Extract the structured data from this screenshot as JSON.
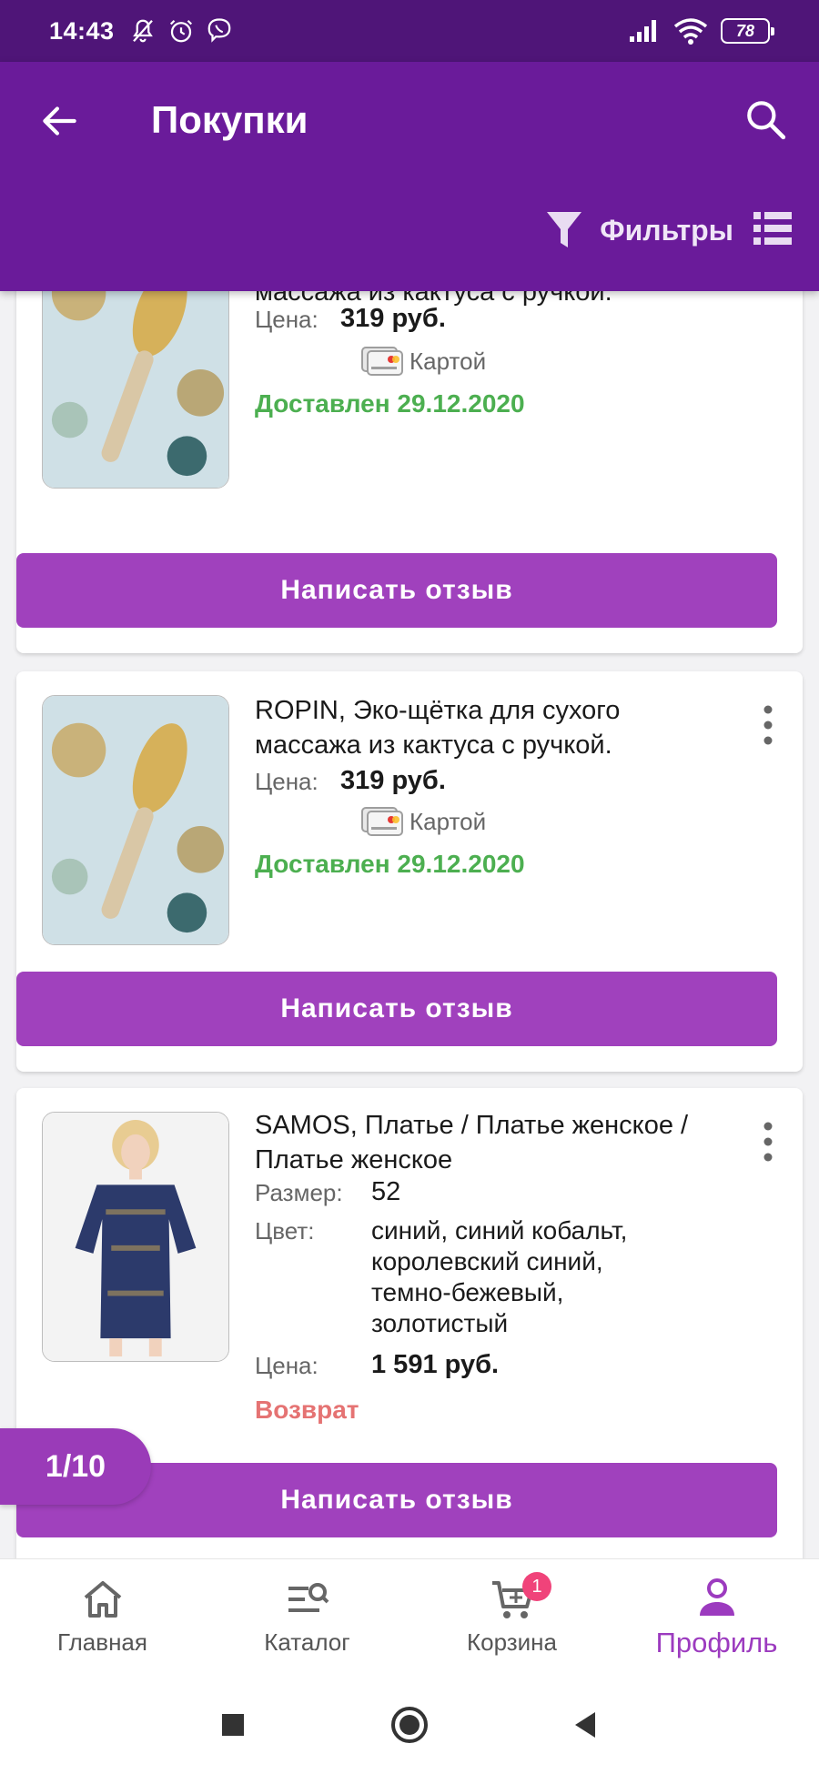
{
  "status_bar": {
    "time": "14:43",
    "battery": "78"
  },
  "header": {
    "title": "Покупки",
    "filters_label": "Фильтры"
  },
  "items": [
    {
      "title": "ROPIN, Эко-щетка для сухого массажа из кактуса с ручкой.",
      "price_label": "Цена:",
      "price": "319 руб.",
      "payment": "Картой",
      "status": "Доставлен 29.12.2020",
      "review_button": "Написать отзыв"
    },
    {
      "title": "ROPIN, Эко-щётка для сухого массажа из кактуса с ручкой.",
      "price_label": "Цена:",
      "price": "319 руб.",
      "payment": "Картой",
      "status": "Доставлен 29.12.2020",
      "review_button": "Написать отзыв"
    },
    {
      "title": "SAMOS, Платье / Платье женское / Платье женское",
      "size_label": "Размер:",
      "size": "52",
      "color_label": "Цвет:",
      "color_lines": [
        "синий, синий кобальт,",
        "королевский синий,",
        "темно-бежевый,",
        "золотистый"
      ],
      "price_label": "Цена:",
      "price": "1 591 руб.",
      "status": "Возврат",
      "review_button": "Написать отзыв"
    }
  ],
  "page_indicator": "1/10",
  "bottom_nav": [
    {
      "label": "Главная",
      "icon": "home-icon"
    },
    {
      "label": "Каталог",
      "icon": "catalog-search-icon"
    },
    {
      "label": "Корзина",
      "icon": "cart-icon",
      "badge": "1"
    },
    {
      "label": "Профиль",
      "icon": "profile-icon",
      "active": true
    }
  ],
  "colors": {
    "status_bar": "#4f1578",
    "header": "#6a1b9a",
    "accent": "#a041bd",
    "delivered": "#4caf50",
    "return": "#e57373",
    "badge": "#f0437a"
  }
}
